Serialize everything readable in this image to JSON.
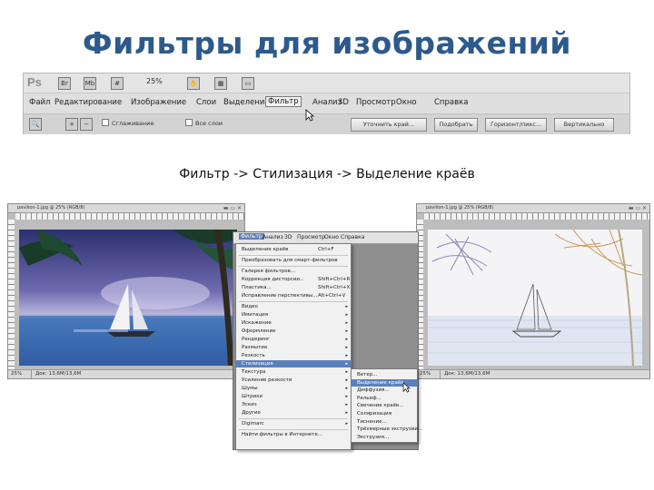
{
  "title": "Фильтры для изображений",
  "caption": "Фильтр -> Стилизация -> Выделение краёв",
  "photoshop": {
    "logo": "Ps",
    "zoom": "25%",
    "menu": [
      "Файл",
      "Редактирование",
      "Изображение",
      "Слои",
      "Выделение",
      "Фильтр",
      "Анализ",
      "3D",
      "Просмотр",
      "Окно",
      "Справка"
    ],
    "active_menu": "Фильтр",
    "options": {
      "checkbox1": "Сглаживание",
      "checkbox2": "Все слои",
      "buttons": [
        "Уточнить край...",
        "Подобрать",
        "Горизонт/пикс...",
        "Вертикально"
      ]
    }
  },
  "doc_left": {
    "title": "pavilion-1.jpg @ 25% (RGB/8)",
    "zoom": "25%",
    "status": "Док: 13,6M/13,6M"
  },
  "doc_right": {
    "title": "pavilion-1.jpg @ 25% (RGB/8)",
    "zoom": "25%",
    "status": "Док: 13,6M/13,6M"
  },
  "filter_window": {
    "menubar": [
      "Фильтр",
      "Анализ",
      "3D",
      "Просмотр",
      "Окно",
      "Справка"
    ],
    "active": "Фильтр"
  },
  "filter_menu": [
    {
      "label": "Выделение краёв",
      "shortcut": "Ctrl+F",
      "arrow": false
    },
    {
      "label": "Преобразовать для смарт-фильтров",
      "shortcut": "",
      "arrow": false,
      "sep_before": true
    },
    {
      "label": "Галерея фильтров...",
      "shortcut": "",
      "arrow": false,
      "sep_before": true
    },
    {
      "label": "Коррекция дисторсии...",
      "shortcut": "Shift+Ctrl+R",
      "arrow": false
    },
    {
      "label": "Пластика...",
      "shortcut": "Shift+Ctrl+X",
      "arrow": false
    },
    {
      "label": "Исправление перспективы...",
      "shortcut": "Alt+Ctrl+V",
      "arrow": false
    },
    {
      "label": "Видео",
      "shortcut": "",
      "arrow": true,
      "sep_before": true
    },
    {
      "label": "Имитация",
      "shortcut": "",
      "arrow": true
    },
    {
      "label": "Искажение",
      "shortcut": "",
      "arrow": true
    },
    {
      "label": "Оформление",
      "shortcut": "",
      "arrow": true
    },
    {
      "label": "Рендеринг",
      "shortcut": "",
      "arrow": true
    },
    {
      "label": "Размытие",
      "shortcut": "",
      "arrow": true
    },
    {
      "label": "Резкость",
      "shortcut": "",
      "arrow": true
    },
    {
      "label": "Стилизация",
      "shortcut": "",
      "arrow": true,
      "highlight": true
    },
    {
      "label": "Текстура",
      "shortcut": "",
      "arrow": true
    },
    {
      "label": "Усиление резкости",
      "shortcut": "",
      "arrow": true
    },
    {
      "label": "Шумы",
      "shortcut": "",
      "arrow": true
    },
    {
      "label": "Штрихи",
      "shortcut": "",
      "arrow": true
    },
    {
      "label": "Эскиз",
      "shortcut": "",
      "arrow": true
    },
    {
      "label": "Другие",
      "shortcut": "",
      "arrow": true
    },
    {
      "label": "Digimarc",
      "shortcut": "",
      "arrow": true,
      "sep_before": true
    },
    {
      "label": "Найти фильтры в Интернете...",
      "shortcut": "",
      "arrow": false,
      "sep_before": true
    }
  ],
  "stylize_submenu": [
    {
      "label": "Ветер...",
      "highlight": false
    },
    {
      "label": "Выделение краёв",
      "highlight": true
    },
    {
      "label": "Диффузия...",
      "highlight": false
    },
    {
      "label": "Рельеф...",
      "highlight": false
    },
    {
      "label": "Свечение краёв...",
      "highlight": false
    },
    {
      "label": "Соляризация",
      "highlight": false
    },
    {
      "label": "Тиснение...",
      "highlight": false
    },
    {
      "label": "Трёхмерные экструзии...",
      "highlight": false
    },
    {
      "label": "Экструзия...",
      "highlight": false
    }
  ],
  "colors": {
    "title": "#2d5a8c",
    "menu_highlight": "#5b81bd"
  }
}
